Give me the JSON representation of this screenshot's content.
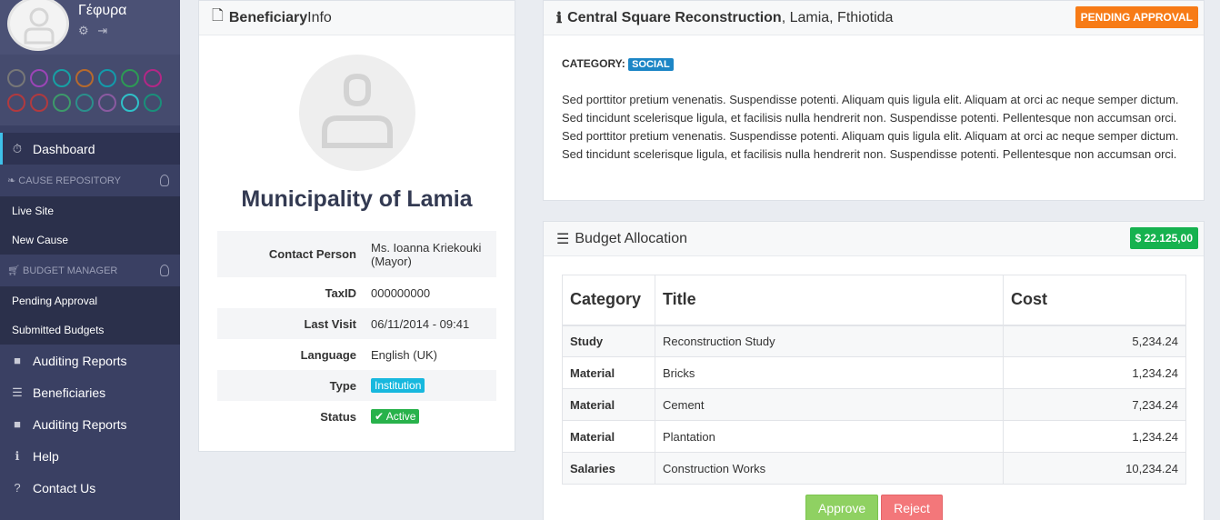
{
  "sidebar": {
    "brand": "Γέφυρα",
    "swatches": [
      [
        "#777777",
        "#9b45b6",
        "#17a0a4",
        "#b76a2d",
        "#139aaa",
        "#2d9a55",
        "#b32786"
      ],
      [
        "#b13a3f",
        "#b13a3f",
        "#3d9a6a",
        "#2b8f8c",
        "#8a5aa0",
        "#2fc0c8",
        "#1a8f7a"
      ]
    ],
    "dashboard": "Dashboard",
    "section_cause": "CAUSE REPOSITORY",
    "cause_items": [
      "Live Site",
      "New Cause"
    ],
    "section_budget": "BUDGET MANAGER",
    "budget_items": [
      "Pending Approval",
      "Submitted Budgets"
    ],
    "main_items": [
      {
        "label": "Auditing Reports",
        "icon": "folder-icon"
      },
      {
        "label": "Beneficiaries",
        "icon": "list-icon"
      },
      {
        "label": "Auditing Reports",
        "icon": "folder-icon"
      },
      {
        "label": "Help",
        "icon": "info-icon"
      },
      {
        "label": "Contact Us",
        "icon": "question-icon"
      }
    ]
  },
  "beneficiary": {
    "title_bold": "Beneficiary",
    "title_rest": " Info",
    "name": "Municipality of Lamia",
    "fields": {
      "contact_label": "Contact Person",
      "contact_value": "Ms. Ioanna Kriekouki (Mayor)",
      "taxid_label": "TaxID",
      "taxid_value": "000000000",
      "lastvisit_label": "Last Visit",
      "lastvisit_value": "06/11/2014 - 09:41",
      "language_label": "Language",
      "language_value": "English (UK)",
      "type_label": "Type",
      "type_value": "Institution",
      "status_label": "Status",
      "status_value": "Active"
    }
  },
  "project": {
    "title_bold": "Central Square Reconstruction",
    "title_rest": ", Lamia, Fthiotida",
    "status_badge": "PENDING APPROVAL",
    "category_label": "CATEGORY:",
    "category_value": "SOCIAL",
    "description": "Sed porttitor pretium venenatis. Suspendisse potenti. Aliquam quis ligula elit. Aliquam at orci ac neque semper dictum. Sed tincidunt scelerisque ligula, et facilisis nulla hendrerit non. Suspendisse potenti. Pellentesque non accumsan orci. Sed porttitor pretium venenatis. Suspendisse potenti. Aliquam quis ligula elit. Aliquam at orci ac neque semper dictum. Sed tincidunt scelerisque ligula, et facilisis nulla hendrerit non. Suspendisse potenti. Pellentesque non accumsan orci."
  },
  "budget": {
    "title": "Budget Allocation",
    "total": "$ 22.125,00",
    "columns": [
      "Category",
      "Title",
      "Cost"
    ],
    "rows": [
      {
        "category": "Study",
        "title": "Reconstruction Study",
        "cost": "5,234.24"
      },
      {
        "category": "Material",
        "title": "Bricks",
        "cost": "1,234.24"
      },
      {
        "category": "Material",
        "title": "Cement",
        "cost": "7,234.24"
      },
      {
        "category": "Material",
        "title": "Plantation",
        "cost": "1,234.24"
      },
      {
        "category": "Salaries",
        "title": "Construction Works",
        "cost": "10,234.24"
      }
    ],
    "approve_label": "Approve",
    "reject_label": "Reject"
  }
}
